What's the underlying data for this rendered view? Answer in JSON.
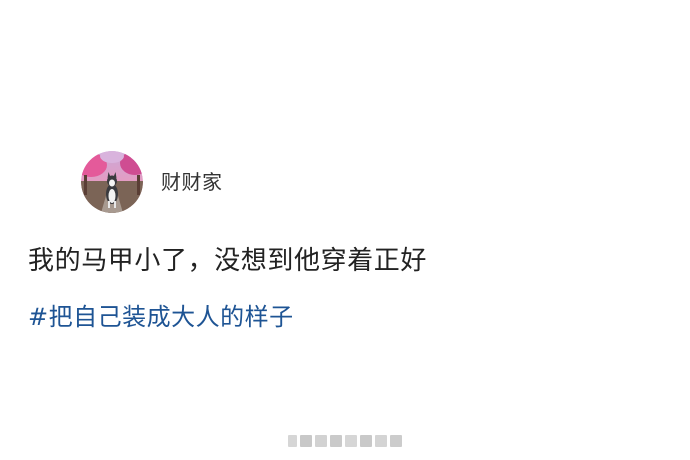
{
  "post": {
    "username": "财财家",
    "text": "我的马甲小了，没想到他穿着正好",
    "hashtag": "#把自己装成大人的样子"
  },
  "colors": {
    "background": "#ffffff",
    "username": "#333333",
    "text": "#222222",
    "hashtag": "#1e5494"
  },
  "icons": {
    "avatar": "husky-dog-photo",
    "watermark": "blurred-watermark"
  }
}
